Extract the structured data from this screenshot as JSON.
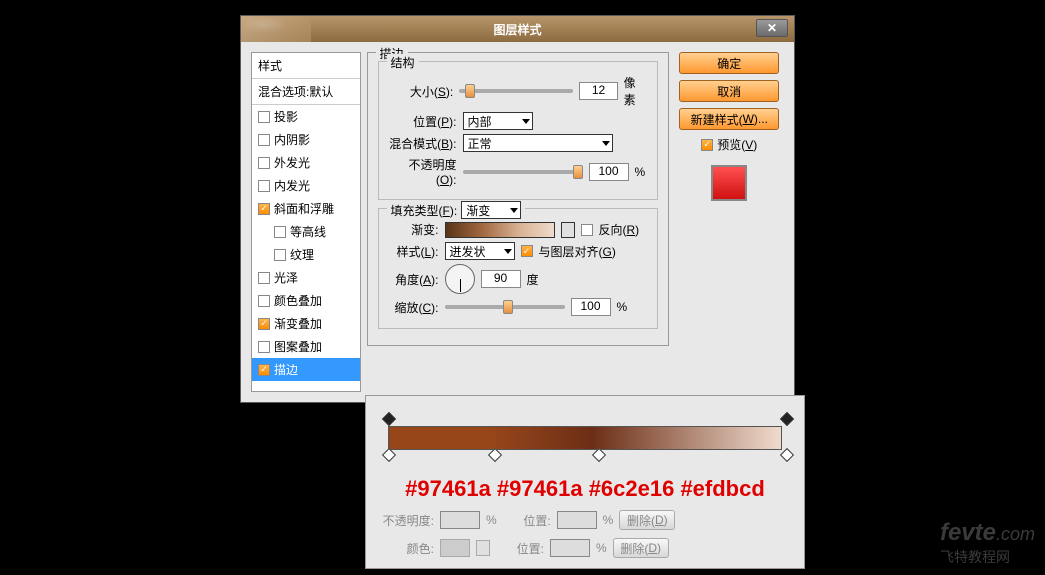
{
  "dialog": {
    "title": "图层样式",
    "sidebar": {
      "header": "样式",
      "blend": "混合选项:默认",
      "items": [
        {
          "label": "投影",
          "checked": false
        },
        {
          "label": "内阴影",
          "checked": false
        },
        {
          "label": "外发光",
          "checked": false
        },
        {
          "label": "内发光",
          "checked": false
        },
        {
          "label": "斜面和浮雕",
          "checked": true
        },
        {
          "label": "等高线",
          "checked": false,
          "indent": true
        },
        {
          "label": "纹理",
          "checked": false,
          "indent": true
        },
        {
          "label": "光泽",
          "checked": false
        },
        {
          "label": "颜色叠加",
          "checked": false
        },
        {
          "label": "渐变叠加",
          "checked": true
        },
        {
          "label": "图案叠加",
          "checked": false
        },
        {
          "label": "描边",
          "checked": true,
          "selected": true
        }
      ]
    },
    "stroke": {
      "group_label": "描边",
      "structure_label": "结构",
      "size_label": "大小(S):",
      "size_value": "12",
      "size_unit": "像素",
      "position_label": "位置(P):",
      "position_value": "内部",
      "blend_label": "混合模式(B):",
      "blend_value": "正常",
      "opacity_label": "不透明度(O):",
      "opacity_value": "100",
      "opacity_unit": "%",
      "fill_group_label": "填充类型(F):",
      "fill_value": "渐变",
      "gradient_label": "渐变:",
      "reverse_label": "反向(R)",
      "style_label": "样式(L):",
      "style_value": "迸发状",
      "align_label": "与图层对齐(G)",
      "angle_label": "角度(A):",
      "angle_value": "90",
      "angle_unit": "度",
      "scale_label": "缩放(C):",
      "scale_value": "100",
      "scale_unit": "%"
    },
    "buttons": {
      "ok": "确定",
      "cancel": "取消",
      "newstyle": "新建样式(W)...",
      "preview": "预览(V)"
    }
  },
  "gradient_editor": {
    "hex_text": "#97461a #97461a #6c2e16 #efdbcd",
    "opacity_label": "不透明度:",
    "pos_label": "位置:",
    "color_label": "颜色:",
    "delete_label": "删除(D)",
    "pct": "%"
  },
  "watermark": {
    "big": "fevte",
    "small": ".com",
    "cn": "飞特教程网"
  },
  "chart_data": {
    "type": "gradient",
    "stops": [
      {
        "position": 0,
        "color": "#97461a"
      },
      {
        "position": 26,
        "color": "#97461a"
      },
      {
        "position": 52,
        "color": "#6c2e16"
      },
      {
        "position": 100,
        "color": "#efdbcd"
      }
    ]
  }
}
